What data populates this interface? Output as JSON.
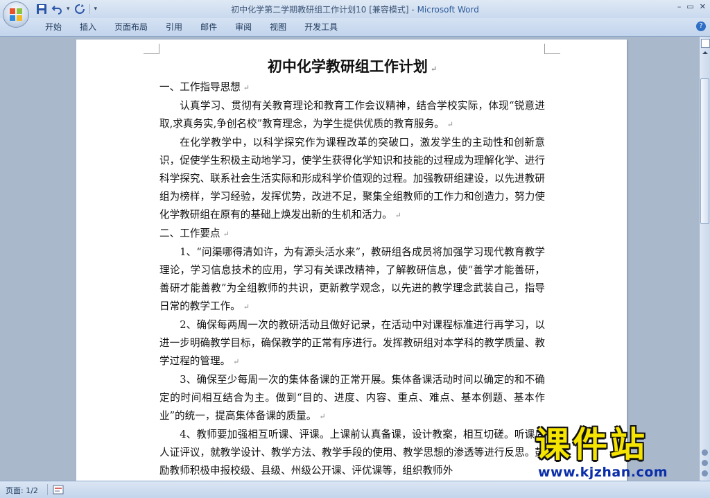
{
  "window": {
    "title_doc": "初中化学第二学期教研组工作计划10 [兼容模式]",
    "title_sep": " - ",
    "title_app": "Microsoft Word"
  },
  "quick_access": {
    "icons": [
      "save-icon",
      "undo-icon",
      "redo-icon",
      "customize-dropdown-icon"
    ]
  },
  "ribbon": {
    "tabs": [
      "开始",
      "插入",
      "页面布局",
      "引用",
      "邮件",
      "审阅",
      "视图",
      "开发工具"
    ]
  },
  "document": {
    "title": "初中化学教研组工作计划",
    "paragraphs": [
      {
        "text": "一、工作指导思想",
        "indent": false
      },
      {
        "text": "认真学习、贯彻有关教育理论和教育工作会议精神，结合学校实际，体现“锐意进取,求真务实,争创名校”教育理念，为学生提供优质的教育服务。",
        "indent": true
      },
      {
        "text": "在化学教学中，以科学探究作为课程改革的突破口，激发学生的主动性和创新意识，促使学生积极主动地学习，使学生获得化学知识和技能的过程成为理解化学、进行科学探究、联系社会生活实际和形成科学价值观的过程。加强教研组建设，以先进教研组为榜样，学习经验，发挥优势，改进不足，聚集全组教师的工作力和创造力，努力使化学教研组在原有的基础上焕发出新的生机和活力。",
        "indent": true
      },
      {
        "text": "二、工作要点",
        "indent": false
      },
      {
        "text": "1、“问渠哪得清如许，为有源头活水来”，教研组各成员将加强学习现代教育教学理论，学习信息技术的应用，学习有关课改精神，了解教研信息，使“善学才能善研，善研才能善教”为全组教师的共识，更新教学观念，以先进的教学理念武装自己，指导日常的教学工作。",
        "indent": true
      },
      {
        "text": "2、确保每两周一次的教研活动且做好记录，在活动中对课程标准进行再学习，以进一步明确教学目标，确保教学的正常有序进行。发挥教研组对本学科的教学质量、教学过程的管理。",
        "indent": true
      },
      {
        "text": "3、确保至少每周一次的集体备课的正常开展。集体备课活动时间以确定的和不确定的时间相互结合为主。做到“目的、进度、内容、重点、难点、基本例题、基本作业”的统一，提高集体备课的质量。",
        "indent": true
      },
      {
        "text": "4、教师要加强相互听课、评课。上课前认真备课，设计教案，相互切磋。听课后人证评议，就教学设计、教学方法、教学手段的使用、教学思想的渗透等进行反思。鼓励教师积极申报校级、县级、州级公开课、评优课等，组织教师外",
        "indent": true
      }
    ],
    "paragraph_mark": "↵"
  },
  "status_bar": {
    "page": "页面: 1/2"
  },
  "watermark": {
    "text": "课件站",
    "url": "www.kjzhan.com"
  }
}
